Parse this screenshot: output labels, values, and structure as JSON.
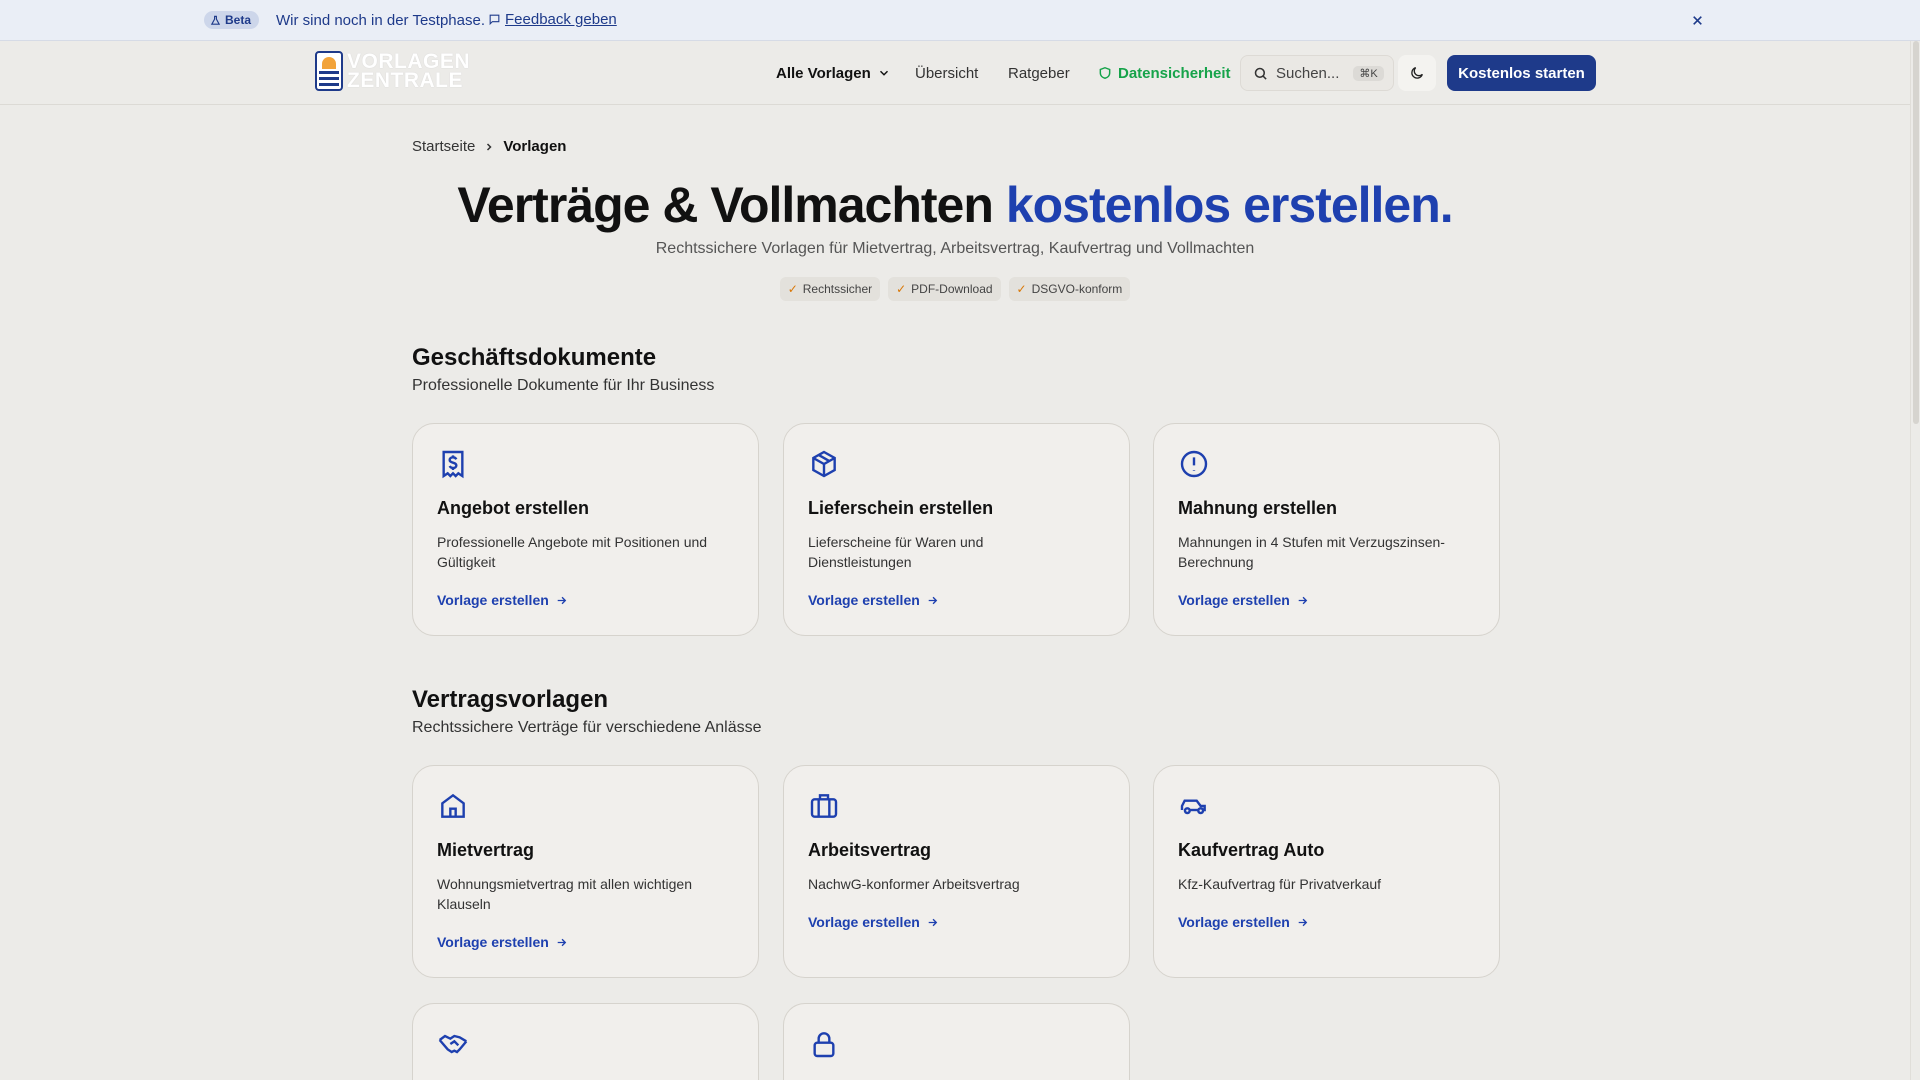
{
  "beta_bar": {
    "badge": "Beta",
    "text": "Wir sind noch in der Testphase.",
    "feedback": "Feedback geben"
  },
  "header": {
    "logo_line1": "VORLAGEN",
    "logo_line2": "ZENTRALE",
    "nav": {
      "alle": "Alle Vorlagen",
      "uebersicht": "Übersicht",
      "ratgeber": "Ratgeber",
      "datensicherheit": "Datensicherheit"
    },
    "search_placeholder": "Suchen...",
    "search_shortcut": "⌘K",
    "cta": "Kostenlos starten"
  },
  "breadcrumb": {
    "home": "Startseite",
    "current": "Vorlagen"
  },
  "hero": {
    "title_main": "Verträge & Vollmachten",
    "title_accent": "kostenlos erstellen.",
    "subtitle": "Rechtssichere Vorlagen für Mietvertrag, Arbeitsvertrag, Kaufvertrag und Vollmachten",
    "badges": [
      "Rechtssicher",
      "PDF-Download",
      "DSGVO-konform"
    ]
  },
  "sections": [
    {
      "title": "Geschäftsdokumente",
      "subtitle": "Professionelle Dokumente für Ihr Business",
      "cards": [
        {
          "icon": "receipt-dollar-icon",
          "title": "Angebot erstellen",
          "desc": "Professionelle Angebote mit Positionen und Gültigkeit",
          "link": "Vorlage erstellen"
        },
        {
          "icon": "package-icon",
          "title": "Lieferschein erstellen",
          "desc": "Lieferscheine für Waren und Dienstleistungen",
          "link": "Vorlage erstellen"
        },
        {
          "icon": "alert-circle-icon",
          "title": "Mahnung erstellen",
          "desc": "Mahnungen in 4 Stufen mit Verzugszinsen-Berechnung",
          "link": "Vorlage erstellen"
        }
      ]
    },
    {
      "title": "Vertragsvorlagen",
      "subtitle": "Rechtssichere Verträge für verschiedene Anlässe",
      "cards": [
        {
          "icon": "home-icon",
          "title": "Mietvertrag",
          "desc": "Wohnungsmietvertrag mit allen wichtigen Klauseln",
          "link": "Vorlage erstellen"
        },
        {
          "icon": "briefcase-icon",
          "title": "Arbeitsvertrag",
          "desc": "NachwG-konformer Arbeitsvertrag",
          "link": "Vorlage erstellen"
        },
        {
          "icon": "car-icon",
          "title": "Kaufvertrag Auto",
          "desc": "Kfz-Kaufvertrag für Privatverkauf",
          "link": "Vorlage erstellen"
        }
      ],
      "partial_cards": [
        {
          "icon": "handshake-icon"
        },
        {
          "icon": "lock-icon"
        }
      ]
    }
  ],
  "colors": {
    "accent": "#1e40af",
    "brand": "#1e3a8a",
    "secure": "#16a34a",
    "check": "#d97706"
  }
}
